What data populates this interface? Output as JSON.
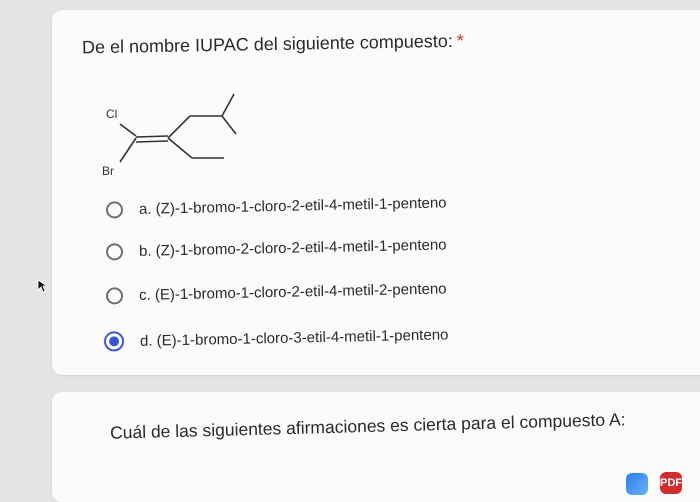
{
  "question1": {
    "title": "De el nombre IUPAC del siguiente compuesto:",
    "required_mark": "*",
    "structure_labels": {
      "cl": "Cl",
      "br": "Br"
    },
    "options": [
      {
        "label": "a. (Z)-1-bromo-1-cloro-2-etil-4-metil-1-penteno",
        "selected": false
      },
      {
        "label": "b. (Z)-1-bromo-2-cloro-2-etil-4-metil-1-penteno",
        "selected": false
      },
      {
        "label": "c. (E)-1-bromo-1-cloro-2-etil-4-metil-2-penteno",
        "selected": false
      },
      {
        "label": "d. (E)-1-bromo-1-cloro-3-etil-4-metil-1-penteno",
        "selected": true
      }
    ]
  },
  "question2": {
    "title": "Cuál de las siguientes afirmaciones es cierta para el compuesto A:"
  },
  "colors": {
    "background": "#e4e4e6",
    "card": "#fbfbfc",
    "radio_selected": "#3a56d4",
    "required": "#d93025"
  },
  "dock": {
    "app2_glyph": "PDF"
  }
}
